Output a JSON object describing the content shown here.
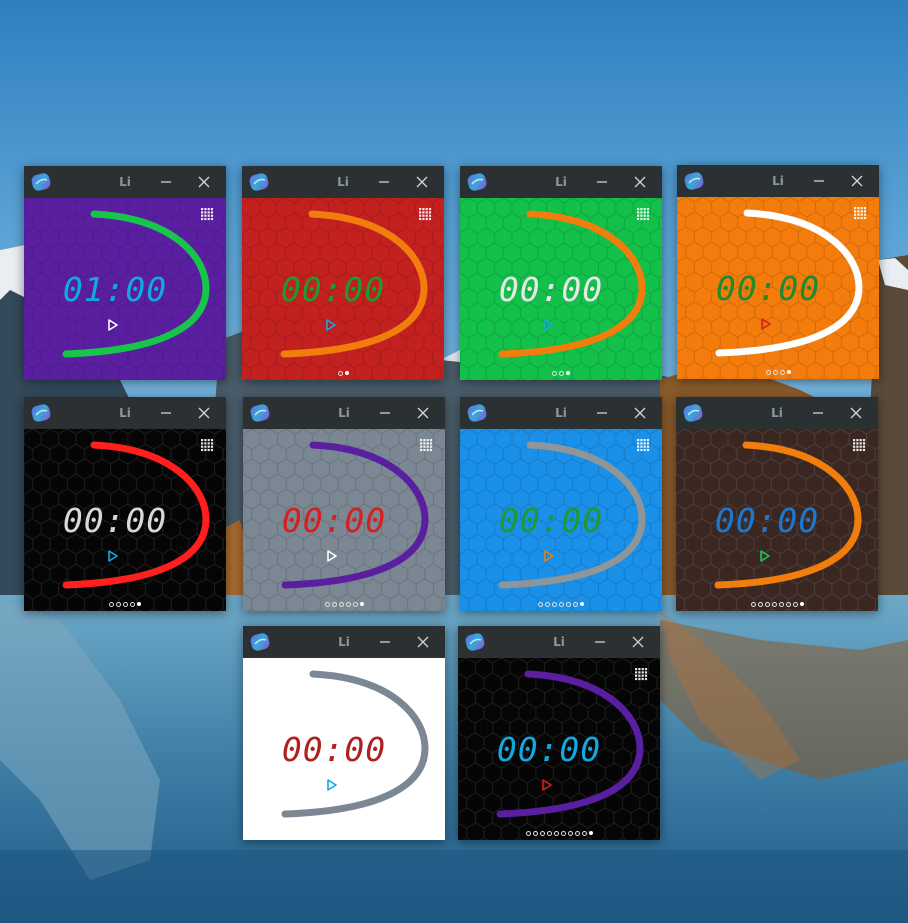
{
  "desktop": {
    "wallpaper": "mountain-lake"
  },
  "windows": [
    {
      "title": "Li",
      "time": "01:00",
      "bg": "#5a1fa0",
      "arc": "#17c54b",
      "time_color": "#12a8e0",
      "play_color": "#ffffff",
      "hex": true,
      "grid_icon": true,
      "pages": 0,
      "active_page": 0
    },
    {
      "title": "Li",
      "time": "00:00",
      "bg": "#c32020",
      "arc": "#f07d0c",
      "time_color": "#1f9a2e",
      "play_color": "#12a8e0",
      "hex": true,
      "grid_icon": true,
      "pages": 2,
      "active_page": 1
    },
    {
      "title": "Li",
      "time": "00:00",
      "bg": "#12c04a",
      "arc": "#f07d0c",
      "time_color": "#e8e8e8",
      "play_color": "#12a8e0",
      "hex": true,
      "grid_icon": true,
      "pages": 3,
      "active_page": 2
    },
    {
      "title": "Li",
      "time": "00:00",
      "bg": "#f47c0c",
      "arc": "#ffffff",
      "time_color": "#1f8a2e",
      "play_color": "#d62020",
      "hex": true,
      "grid_icon": true,
      "pages": 4,
      "active_page": 3
    },
    {
      "title": "Li",
      "time": "00:00",
      "bg": "#050505",
      "arc": "#ff1f1f",
      "time_color": "#d8d8d8",
      "play_color": "#12a8e0",
      "hex": true,
      "grid_icon": true,
      "pages": 5,
      "active_page": 4
    },
    {
      "title": "Li",
      "time": "00:00",
      "bg": "#7b8792",
      "arc": "#5a1fa0",
      "time_color": "#d62020",
      "play_color": "#ffffff",
      "hex": true,
      "grid_icon": true,
      "pages": 6,
      "active_page": 5
    },
    {
      "title": "Li",
      "time": "00:00",
      "bg": "#1a90e8",
      "arc": "#8e969a",
      "time_color": "#1f9a2e",
      "play_color": "#f07d0c",
      "hex": true,
      "grid_icon": true,
      "pages": 7,
      "active_page": 6
    },
    {
      "title": "Li",
      "time": "00:00",
      "bg": "#3b2722",
      "arc": "#f07d0c",
      "time_color": "#1a78d0",
      "play_color": "#17c54b",
      "hex": true,
      "grid_icon": true,
      "pages": 8,
      "active_page": 7
    },
    {
      "title": "Li",
      "time": "00:00",
      "bg": "#ffffff",
      "arc": "#7b8792",
      "time_color": "#b02020",
      "play_color": "#12a8e0",
      "hex": false,
      "grid_icon": false,
      "pages": 0,
      "active_page": 0
    },
    {
      "title": "Li",
      "time": "00:00",
      "bg": "#050505",
      "arc": "#5a1fa0",
      "time_color": "#12a8e0",
      "play_color": "#d62020",
      "hex": true,
      "grid_icon": true,
      "pages": 10,
      "active_page": 9
    }
  ]
}
